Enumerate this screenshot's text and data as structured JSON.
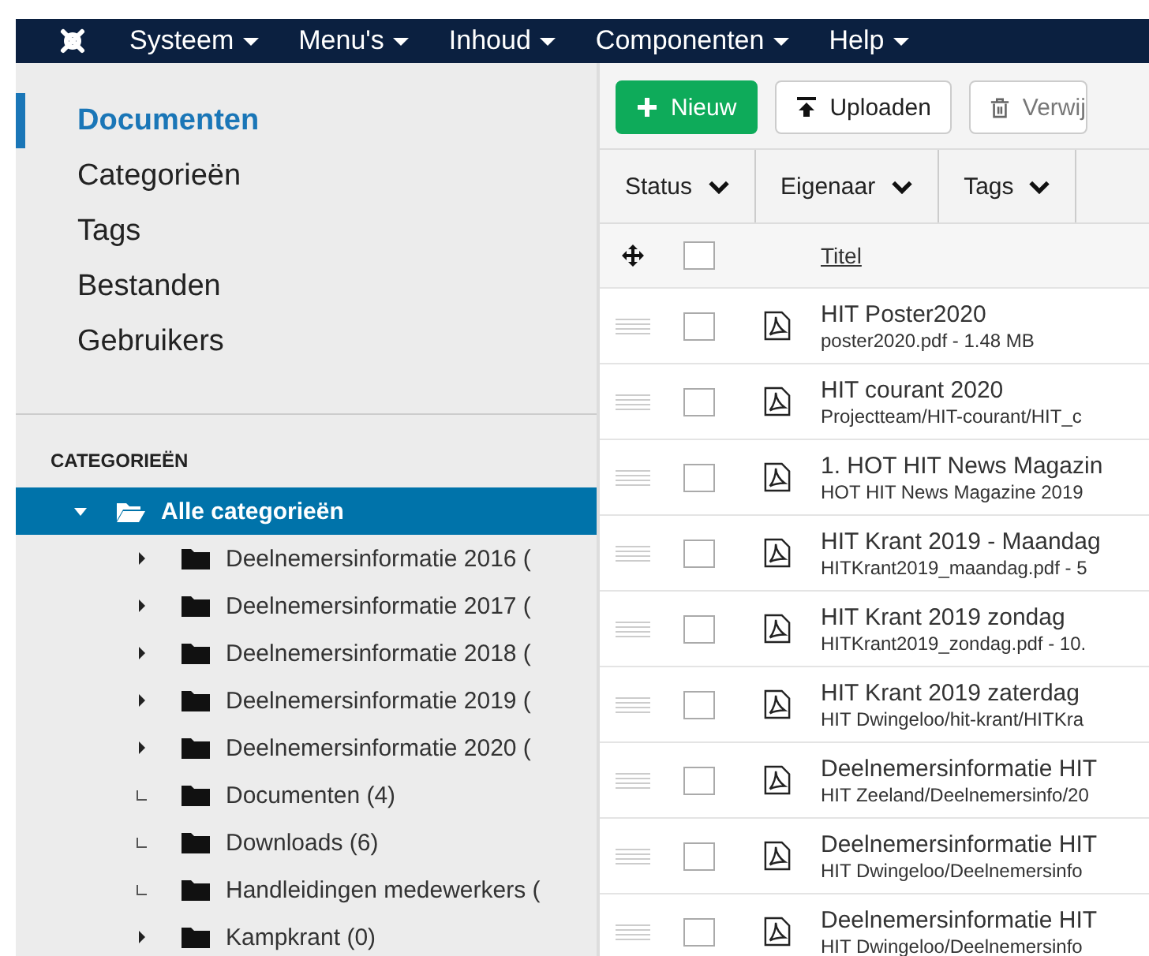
{
  "menu": [
    {
      "label": "Systeem"
    },
    {
      "label": "Menu's"
    },
    {
      "label": "Inhoud"
    },
    {
      "label": "Componenten"
    },
    {
      "label": "Help"
    }
  ],
  "sidebar": {
    "items": [
      {
        "label": "Documenten",
        "selected": true
      },
      {
        "label": "Categorieën",
        "selected": false
      },
      {
        "label": "Tags",
        "selected": false
      },
      {
        "label": "Bestanden",
        "selected": false
      },
      {
        "label": "Gebruikers",
        "selected": false
      }
    ],
    "categories_heading": "CATEGORIEËN",
    "tree": [
      {
        "label": "Alle categorieën",
        "selected": true,
        "expanded": true,
        "children": [
          {
            "label": "Deelnemersinformatie 2016 (",
            "selected": false,
            "expanded": false,
            "has_children": true
          },
          {
            "label": "Deelnemersinformatie 2017 (",
            "selected": false,
            "expanded": false,
            "has_children": true
          },
          {
            "label": "Deelnemersinformatie 2018 (",
            "selected": false,
            "expanded": false,
            "has_children": true
          },
          {
            "label": "Deelnemersinformatie 2019 (",
            "selected": false,
            "expanded": false,
            "has_children": true
          },
          {
            "label": "Deelnemersinformatie 2020 (",
            "selected": false,
            "expanded": false,
            "has_children": true
          },
          {
            "label": "Documenten (4)",
            "selected": false,
            "has_children": false
          },
          {
            "label": "Downloads (6)",
            "selected": false,
            "has_children": false
          },
          {
            "label": "Handleidingen medewerkers (",
            "selected": false,
            "has_children": false
          },
          {
            "label": "Kampkrant (0)",
            "selected": false,
            "expanded": false,
            "has_children": true
          }
        ]
      }
    ]
  },
  "toolbar": [
    {
      "label": "Nieuw",
      "kind": "new"
    },
    {
      "label": "Uploaden",
      "kind": "upload"
    },
    {
      "label": "Verwij",
      "kind": "delete"
    }
  ],
  "filters": [
    {
      "label": "Status"
    },
    {
      "label": "Eigenaar"
    },
    {
      "label": "Tags"
    }
  ],
  "table": {
    "title_column": "Titel",
    "select_all_checked": false,
    "rows": [
      {
        "title": "HIT Poster2020",
        "subtitle": "poster2020.pdf - 1.48 MB",
        "checked": false
      },
      {
        "title": "HIT courant 2020",
        "subtitle": "Projectteam/HIT-courant/HIT_c",
        "checked": false
      },
      {
        "title": "1. HOT HIT News Magazin",
        "subtitle": "HOT HIT News Magazine 2019",
        "checked": false
      },
      {
        "title": "HIT Krant 2019 - Maandag",
        "subtitle": "HITKrant2019_maandag.pdf - 5",
        "checked": false
      },
      {
        "title": "HIT Krant 2019 zondag",
        "subtitle": "HITKrant2019_zondag.pdf - 10.",
        "checked": false
      },
      {
        "title": "HIT Krant 2019 zaterdag",
        "subtitle": "HIT Dwingeloo/hit-krant/HITKra",
        "checked": false
      },
      {
        "title": "Deelnemersinformatie HIT",
        "subtitle": "HIT Zeeland/Deelnemersinfo/20",
        "checked": false
      },
      {
        "title": "Deelnemersinformatie HIT",
        "subtitle": "HIT Dwingeloo/Deelnemersinfo",
        "checked": false
      },
      {
        "title": "Deelnemersinformatie HIT",
        "subtitle": "HIT Dwingeloo/Deelnemersinfo",
        "checked": false
      }
    ]
  }
}
